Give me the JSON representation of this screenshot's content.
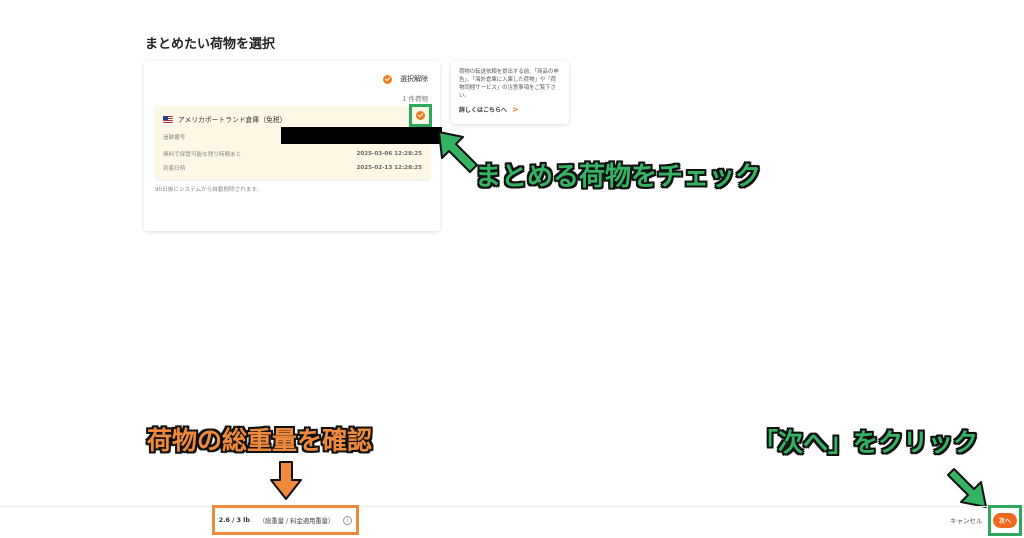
{
  "page": {
    "title": "まとめたい荷物を選択"
  },
  "selection": {
    "deselect_label": "選択解除",
    "count_label": "1 件荷物"
  },
  "package": {
    "warehouse": "アメリカポートランド倉庫（免税）",
    "tracking_label": "追跡番号",
    "storage_label": "無料で保管可能な残り時間あと",
    "storage_value": "2025-03-06 12:28:25",
    "arrival_label": "到着日時",
    "arrival_value": "2025-02-13 12:28:25",
    "auto_delete_note": "90日後にシステムから自動削除されます。"
  },
  "notice": {
    "text": "荷物の転送依頼を提出する前、「商品の申告」、「海外倉庫に入庫した荷物」や「荷物同梱サービス」の注意事項をご覧下さい。",
    "link_label": "詳しくはこちらへ",
    "link_chevron": ">"
  },
  "annotations": {
    "check_callout": "まとめる荷物をチェック",
    "weight_callout": "荷物の総重量を確認",
    "next_callout": "「次へ」をクリック"
  },
  "footer": {
    "weight_value": "2.6 / 3 lb",
    "weight_caption": "（総重量 / 料金適用重量）",
    "info_glyph": "i",
    "cancel_label": "キャンセル",
    "next_label": "次へ"
  },
  "colors": {
    "accent_orange": "#ef7d22",
    "highlight_green": "#2ea85c",
    "package_bg": "#fdf8e6"
  }
}
